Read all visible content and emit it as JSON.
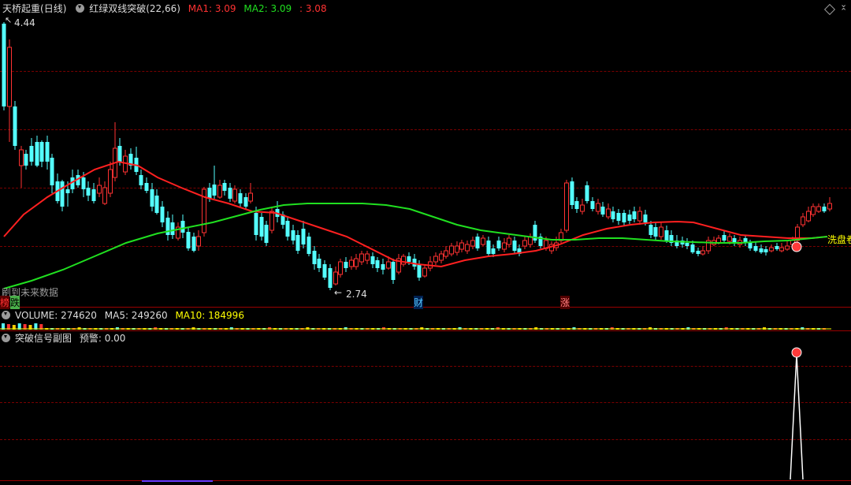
{
  "main_title": {
    "stock_name": "天桥起重",
    "period": "(日线)",
    "indicator_name": "红绿双线突破",
    "indicator_params": "(22,66)",
    "ma1_label": "MA1: 3.09",
    "ma2_label": "MA2: 3.09",
    "extra_value": ": 3.08"
  },
  "price_high_label": "4.44",
  "price_low_label": "2.74",
  "future_data_label": "刷到未来数据",
  "markers": {
    "left_red": "榜",
    "left_green": "跌",
    "cai": "财",
    "zhang": "涨",
    "xipan": "洗盘卷"
  },
  "volume_title": {
    "volume": "VOLUME: 274620",
    "ma5": "MA5: 249260",
    "ma10": "MA10: 184996"
  },
  "signal_title": {
    "name": "突破信号副图",
    "warning": "预警: 0.00"
  },
  "colors": {
    "up": "#ff3232",
    "down": "#54ffff",
    "ma_red": "#ff2020",
    "ma_green": "#20e020",
    "yellow": "#ffff00",
    "white": "#ffffff",
    "grid": "#7a0000"
  },
  "icons": [
    "dropdown-circle-icon",
    "diamond-icon",
    "chevron-down-icon",
    "chevron-up-icon"
  ]
}
